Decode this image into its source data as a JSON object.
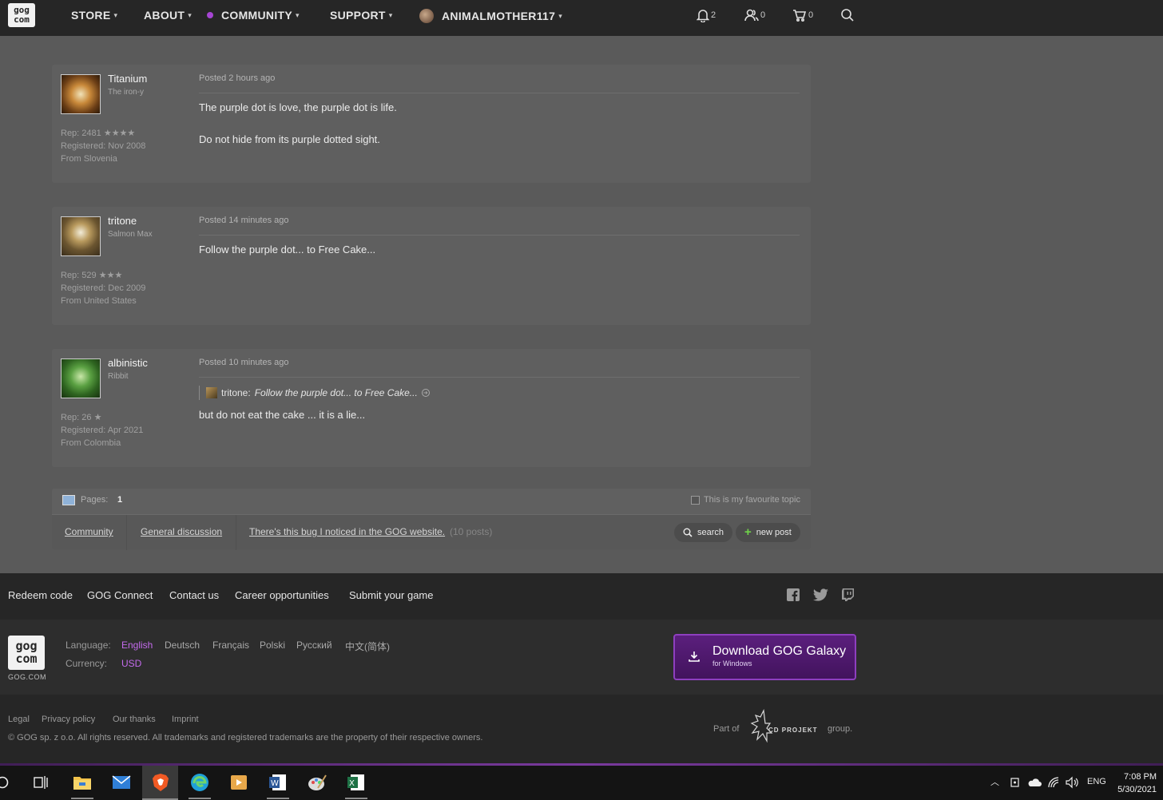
{
  "nav": {
    "store": "STORE",
    "about": "ABOUT",
    "community": "COMMUNITY",
    "support": "SUPPORT",
    "username": "ANIMALMOTHER117",
    "notifications_count": "2",
    "friends_count": "0",
    "cart_count": "0"
  },
  "posts": [
    {
      "username": "Titanium",
      "user_title": "The iron-y",
      "rep": "Rep: 2481",
      "stars": "★★★★",
      "registered": "Registered: Nov 2008",
      "from": "From Slovenia",
      "posted": "Posted 2 hours ago",
      "lines": [
        "The purple dot is love, the purple dot is life.",
        "Do not hide from its purple dotted sight."
      ]
    },
    {
      "username": "tritone",
      "user_title": "Salmon Max",
      "rep": "Rep: 529",
      "stars": "★★★",
      "registered": "Registered: Dec 2009",
      "from": "From United States",
      "posted": "Posted 14 minutes ago",
      "lines": [
        "Follow the purple dot... to Free Cake..."
      ]
    },
    {
      "username": "albinistic",
      "user_title": "Ribbit",
      "rep": "Rep: 26",
      "stars": "★",
      "registered": "Registered: Apr 2021",
      "from": "From Colombia",
      "posted": "Posted 10 minutes ago",
      "quote_name": "tritone:",
      "quote_text": "Follow the purple dot... to Free Cake...",
      "lines": [
        "but do not eat the cake ... it is a lie..."
      ]
    }
  ],
  "pages": {
    "label": "Pages:",
    "current": "1",
    "favourite": "This is my favourite topic"
  },
  "breadcrumb": {
    "community": "Community",
    "general": "General discussion",
    "topic": "There's this bug I noticed in the GOG website.",
    "count": "(10 posts)"
  },
  "buttons": {
    "search": "search",
    "new_post": "new post"
  },
  "footer": {
    "links": [
      "Redeem code",
      "GOG Connect",
      "Contact us",
      "Career opportunities",
      "Submit your game"
    ],
    "language_label": "Language:",
    "languages": [
      "English",
      "Deutsch",
      "Français",
      "Polski",
      "Русский",
      "中文(简体)"
    ],
    "currency_label": "Currency:",
    "currency": "USD",
    "gogcom": "GOG.COM",
    "galaxy_title": "Download GOG Galaxy",
    "galaxy_sub": "for Windows",
    "legal_links": [
      "Legal",
      "Privacy policy",
      "Our thanks",
      "Imprint"
    ],
    "copyright": "© GOG sp. z o.o. All rights reserved. All trademarks and registered trademarks are the property of their respective owners.",
    "part_of": "Part of",
    "cd_projekt": "CD PROJEKT",
    "group": "group."
  },
  "taskbar": {
    "lang": "ENG",
    "time": "7:08 PM",
    "date": "5/30/2021"
  },
  "colors": {
    "accent_purple": "#a645d3",
    "nav_bg": "#262626",
    "page_bg": "#5a5a5a"
  }
}
